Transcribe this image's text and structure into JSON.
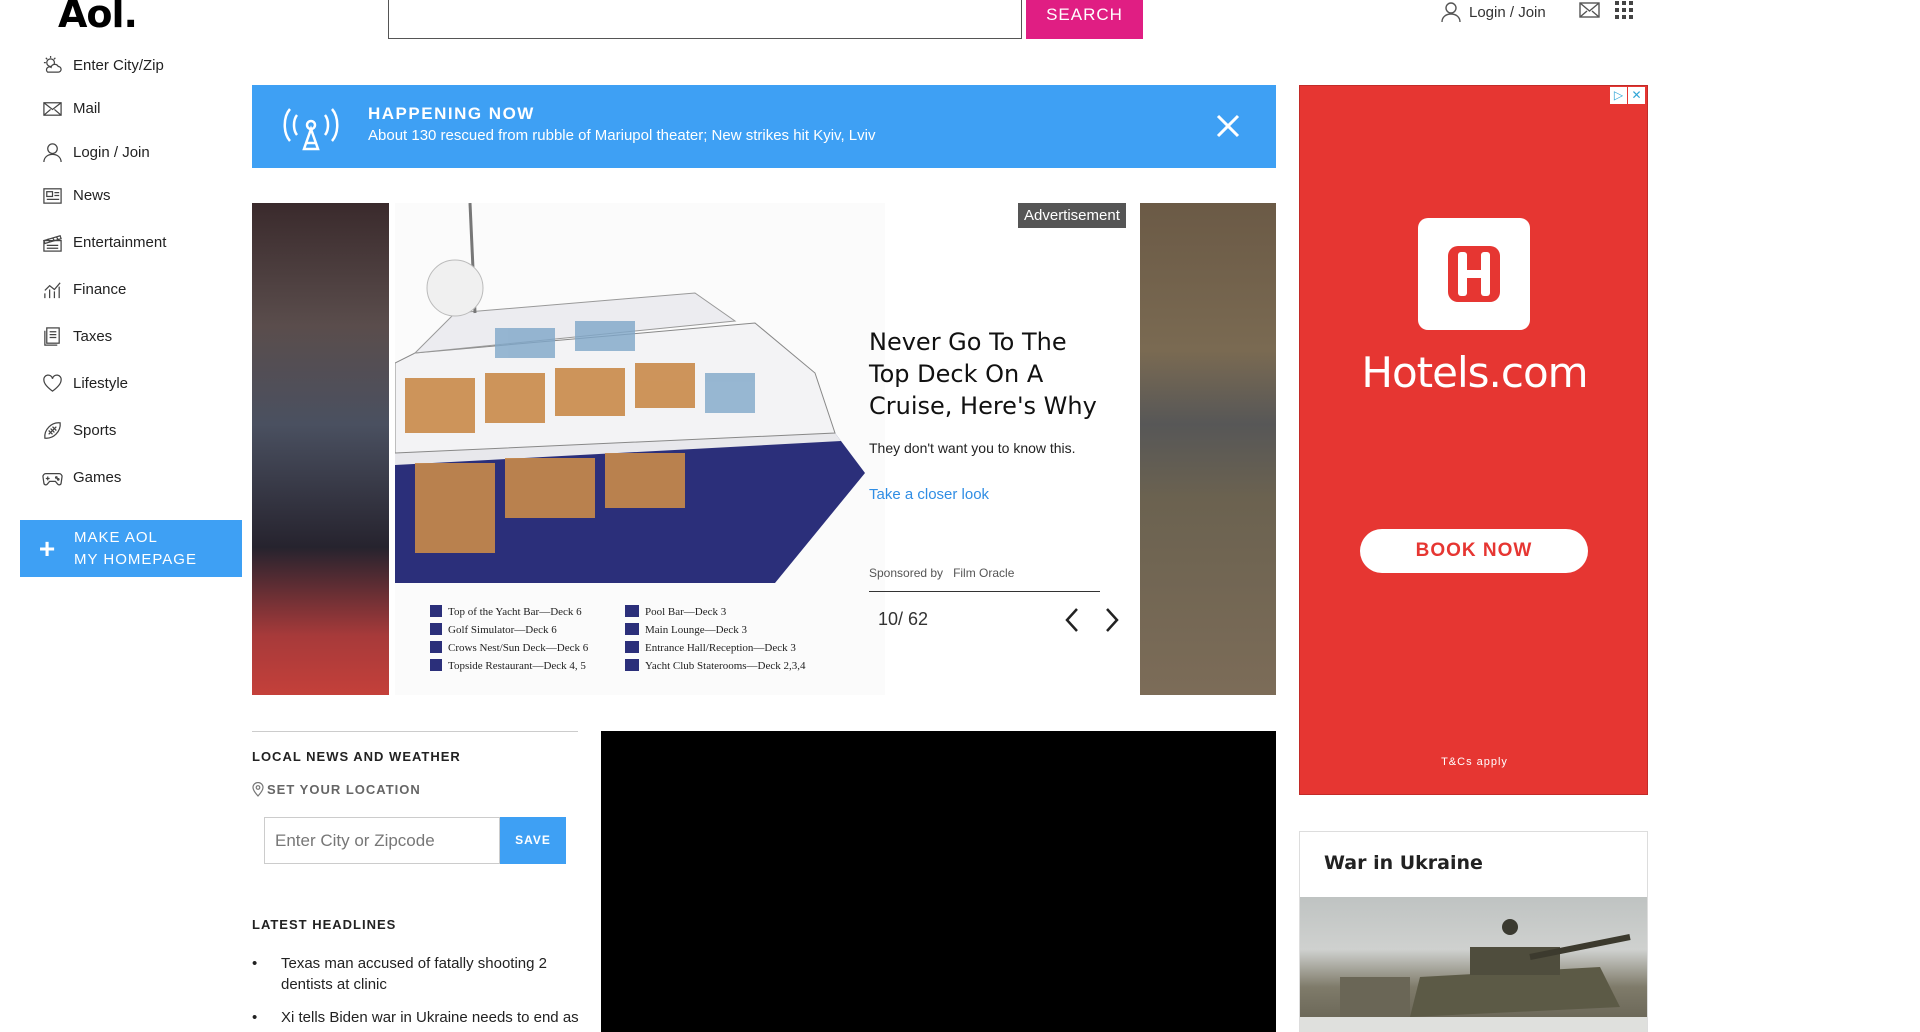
{
  "header": {
    "logo": "Aol.",
    "search_placeholder": "",
    "search_label": "SEARCH",
    "login_label": "Login / Join"
  },
  "nav": {
    "items": [
      {
        "label": "Enter City/Zip",
        "icon": "weather-icon"
      },
      {
        "label": "Mail",
        "icon": "mail-icon"
      },
      {
        "label": "Login / Join",
        "icon": "user-icon"
      },
      {
        "label": "News",
        "icon": "news-icon"
      },
      {
        "label": "Entertainment",
        "icon": "clapper-icon"
      },
      {
        "label": "Finance",
        "icon": "chart-icon"
      },
      {
        "label": "Taxes",
        "icon": "document-icon"
      },
      {
        "label": "Lifestyle",
        "icon": "heart-icon"
      },
      {
        "label": "Sports",
        "icon": "football-icon"
      },
      {
        "label": "Games",
        "icon": "gamepad-icon"
      }
    ],
    "make_home_line1": "MAKE AOL",
    "make_home_line2": "MY HOMEPAGE"
  },
  "banner": {
    "title": "HAPPENING NOW",
    "text": "About 130 rescued from rubble of Mariupol theater; New strikes hit Kyiv, Lviv"
  },
  "carousel": {
    "ad_label": "Advertisement",
    "title": "Never Go To The Top Deck On A Cruise, Here's Why",
    "subtitle": "They don't want you to know this.",
    "link": "Take a closer look",
    "sponsored_by": "Sponsored by",
    "sponsor": "Film Oracle",
    "counter": "10/ 62"
  },
  "local": {
    "heading": "LOCAL NEWS AND WEATHER",
    "set_location": "SET YOUR LOCATION",
    "zip_placeholder": "Enter City or Zipcode",
    "save_label": "SAVE",
    "headlines_heading": "LATEST HEADLINES",
    "headlines": [
      "Texas man accused of fatally shooting 2 dentists at clinic",
      "Xi tells Biden war in Ukraine needs to end as soon as possible - Chinese state media"
    ]
  },
  "ad_rail": {
    "brand": "Hotels.com",
    "cta": "BOOK NOW",
    "terms": "T&Cs apply",
    "color": "#e63632"
  },
  "war_card": {
    "title": "War in Ukraine"
  },
  "colors": {
    "accent_blue": "#3ea0f4",
    "search_pink": "#e01e83",
    "link_blue": "#2f8de4"
  }
}
